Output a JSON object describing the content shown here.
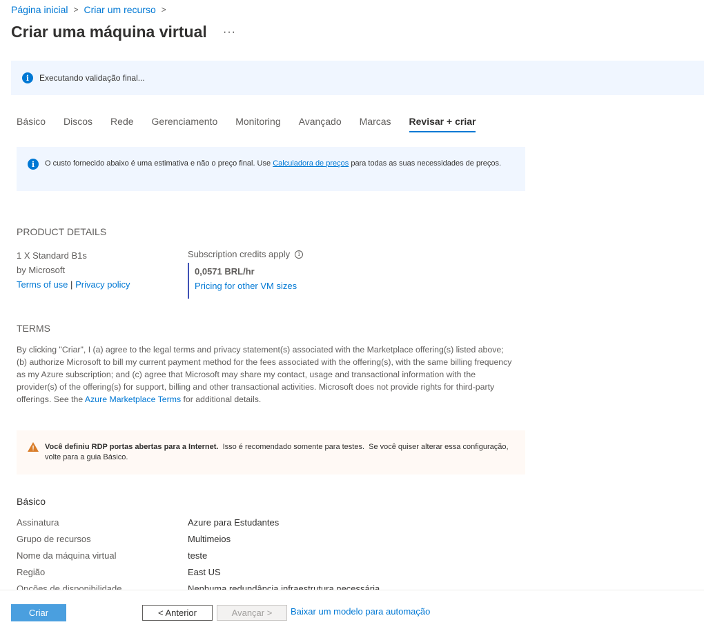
{
  "breadcrumb": {
    "home": "Página inicial",
    "create": "Criar um recurso",
    "sep": ">"
  },
  "title": "Criar uma máquina virtual",
  "more": "···",
  "validation": {
    "icon": "info-icon",
    "text": "Executando validação final..."
  },
  "tabs": [
    "Básico",
    "Discos",
    "Rede",
    "Gerenciamento",
    "Monitoring",
    "Avançado",
    "Marcas",
    "Revisar + criar"
  ],
  "active_tab": "Revisar + criar",
  "cost_notice": {
    "before": "O custo fornecido abaixo é uma estimativa e não o preço final. Use ",
    "link": "Calculadora de preços",
    "after": " para todas as suas necessidades de preços."
  },
  "product_details": {
    "heading": "PRODUCT DETAILS",
    "sku": "1 X Standard B1s",
    "publisher": "by Microsoft",
    "terms_link": "Terms of use",
    "divider": "|",
    "privacy_link": "Privacy policy",
    "credits_label": "Subscription credits apply",
    "price": "0,0571 BRL/hr",
    "pricing_link": "Pricing for other VM sizes"
  },
  "terms": {
    "heading": "TERMS",
    "before": "By clicking \"Criar\", I (a) agree to the legal terms and privacy statement(s) associated with the Marketplace offering(s) listed above; (b) authorize Microsoft to bill my current payment method for the fees associated with the offering(s), with the same billing frequency as my Azure subscription; and (c) agree that Microsoft may share my contact, usage and transactional information with the provider(s) of the offering(s) for support, billing and other transactional activities. Microsoft does not provide rights for third-party offerings. See the ",
    "link": "Azure Marketplace Terms",
    "after": " for additional details."
  },
  "warning": {
    "bold": "Você definiu RDP portas abertas para a Internet.",
    "text": "  Isso é recomendado somente para testes.  Se você quiser alterar essa configuração, volte para a guia Básico."
  },
  "basics": {
    "heading": "Básico",
    "rows": [
      {
        "label": "Assinatura",
        "value": "Azure para Estudantes"
      },
      {
        "label": "Grupo de recursos",
        "value": "Multimeios"
      },
      {
        "label": "Nome da máquina virtual",
        "value": "teste"
      },
      {
        "label": "Região",
        "value": "East US"
      },
      {
        "label": "Opções de disponibilidade",
        "value": "Nenhuma redundância infraestrutura necessária"
      }
    ]
  },
  "footer": {
    "create": "Criar",
    "previous": "< Anterior",
    "next": "Avançar >",
    "download": "Baixar um modelo para automação"
  },
  "colors": {
    "accent": "#0078d4",
    "primary_button": "#4a9fdf",
    "warning": "#d97d2a",
    "info_bg": "#f0f6ff"
  }
}
